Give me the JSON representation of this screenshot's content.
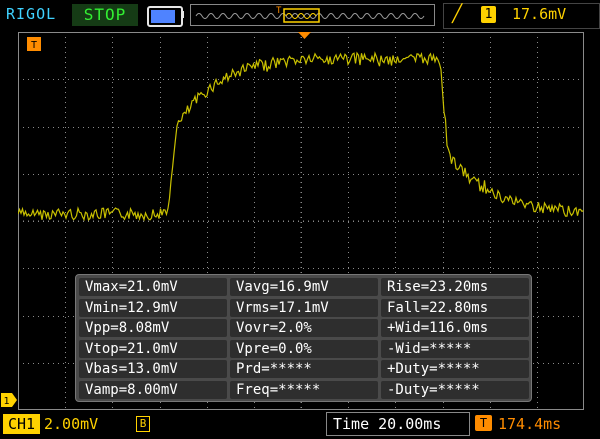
{
  "header": {
    "brand": "RIGOL",
    "run_state": "STOP",
    "trigger_edge_icon": "rising-edge-icon",
    "trigger_source": "1",
    "trigger_level": "17.6mV"
  },
  "markers": {
    "trigger_tag": "T",
    "channel_tag": "1"
  },
  "measurements": [
    [
      "Vmax=21.0mV",
      "Vavg=16.9mV",
      "Rise=23.20ms"
    ],
    [
      "Vmin=12.9mV",
      "Vrms=17.1mV",
      "Fall=22.80ms"
    ],
    [
      "Vpp=8.08mV",
      "Vovr=2.0%",
      "+Wid=116.0ms"
    ],
    [
      "Vtop=21.0mV",
      "Vpre=0.0%",
      "-Wid=*****"
    ],
    [
      "Vbas=13.0mV",
      "Prd=*****",
      "+Duty=*****"
    ],
    [
      "Vamp=8.00mV",
      "Freq=*****",
      "-Duty=*****"
    ]
  ],
  "footer": {
    "channel_label": "CH1",
    "volts_per_div": "2.00mV",
    "bandwidth_mark": "B",
    "time_label": "Time 20.00ms",
    "offset_tag": "T",
    "trigger_offset": "174.4ms"
  },
  "colors": {
    "trace": "#c8c000",
    "grid": "#8a8a8a",
    "channel": "#ffd200",
    "trigger": "#ff8c00",
    "stop_text": "#32f032",
    "brand": "#3fd2ff"
  }
}
